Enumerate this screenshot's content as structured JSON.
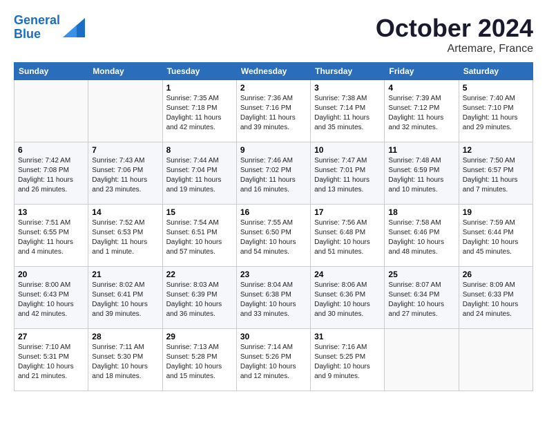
{
  "header": {
    "logo_line1": "General",
    "logo_line2": "Blue",
    "month": "October 2024",
    "location": "Artemare, France"
  },
  "days_of_week": [
    "Sunday",
    "Monday",
    "Tuesday",
    "Wednesday",
    "Thursday",
    "Friday",
    "Saturday"
  ],
  "weeks": [
    [
      {
        "day": "",
        "info": ""
      },
      {
        "day": "",
        "info": ""
      },
      {
        "day": "1",
        "info": "Sunrise: 7:35 AM\nSunset: 7:18 PM\nDaylight: 11 hours and 42 minutes."
      },
      {
        "day": "2",
        "info": "Sunrise: 7:36 AM\nSunset: 7:16 PM\nDaylight: 11 hours and 39 minutes."
      },
      {
        "day": "3",
        "info": "Sunrise: 7:38 AM\nSunset: 7:14 PM\nDaylight: 11 hours and 35 minutes."
      },
      {
        "day": "4",
        "info": "Sunrise: 7:39 AM\nSunset: 7:12 PM\nDaylight: 11 hours and 32 minutes."
      },
      {
        "day": "5",
        "info": "Sunrise: 7:40 AM\nSunset: 7:10 PM\nDaylight: 11 hours and 29 minutes."
      }
    ],
    [
      {
        "day": "6",
        "info": "Sunrise: 7:42 AM\nSunset: 7:08 PM\nDaylight: 11 hours and 26 minutes."
      },
      {
        "day": "7",
        "info": "Sunrise: 7:43 AM\nSunset: 7:06 PM\nDaylight: 11 hours and 23 minutes."
      },
      {
        "day": "8",
        "info": "Sunrise: 7:44 AM\nSunset: 7:04 PM\nDaylight: 11 hours and 19 minutes."
      },
      {
        "day": "9",
        "info": "Sunrise: 7:46 AM\nSunset: 7:02 PM\nDaylight: 11 hours and 16 minutes."
      },
      {
        "day": "10",
        "info": "Sunrise: 7:47 AM\nSunset: 7:01 PM\nDaylight: 11 hours and 13 minutes."
      },
      {
        "day": "11",
        "info": "Sunrise: 7:48 AM\nSunset: 6:59 PM\nDaylight: 11 hours and 10 minutes."
      },
      {
        "day": "12",
        "info": "Sunrise: 7:50 AM\nSunset: 6:57 PM\nDaylight: 11 hours and 7 minutes."
      }
    ],
    [
      {
        "day": "13",
        "info": "Sunrise: 7:51 AM\nSunset: 6:55 PM\nDaylight: 11 hours and 4 minutes."
      },
      {
        "day": "14",
        "info": "Sunrise: 7:52 AM\nSunset: 6:53 PM\nDaylight: 11 hours and 1 minute."
      },
      {
        "day": "15",
        "info": "Sunrise: 7:54 AM\nSunset: 6:51 PM\nDaylight: 10 hours and 57 minutes."
      },
      {
        "day": "16",
        "info": "Sunrise: 7:55 AM\nSunset: 6:50 PM\nDaylight: 10 hours and 54 minutes."
      },
      {
        "day": "17",
        "info": "Sunrise: 7:56 AM\nSunset: 6:48 PM\nDaylight: 10 hours and 51 minutes."
      },
      {
        "day": "18",
        "info": "Sunrise: 7:58 AM\nSunset: 6:46 PM\nDaylight: 10 hours and 48 minutes."
      },
      {
        "day": "19",
        "info": "Sunrise: 7:59 AM\nSunset: 6:44 PM\nDaylight: 10 hours and 45 minutes."
      }
    ],
    [
      {
        "day": "20",
        "info": "Sunrise: 8:00 AM\nSunset: 6:43 PM\nDaylight: 10 hours and 42 minutes."
      },
      {
        "day": "21",
        "info": "Sunrise: 8:02 AM\nSunset: 6:41 PM\nDaylight: 10 hours and 39 minutes."
      },
      {
        "day": "22",
        "info": "Sunrise: 8:03 AM\nSunset: 6:39 PM\nDaylight: 10 hours and 36 minutes."
      },
      {
        "day": "23",
        "info": "Sunrise: 8:04 AM\nSunset: 6:38 PM\nDaylight: 10 hours and 33 minutes."
      },
      {
        "day": "24",
        "info": "Sunrise: 8:06 AM\nSunset: 6:36 PM\nDaylight: 10 hours and 30 minutes."
      },
      {
        "day": "25",
        "info": "Sunrise: 8:07 AM\nSunset: 6:34 PM\nDaylight: 10 hours and 27 minutes."
      },
      {
        "day": "26",
        "info": "Sunrise: 8:09 AM\nSunset: 6:33 PM\nDaylight: 10 hours and 24 minutes."
      }
    ],
    [
      {
        "day": "27",
        "info": "Sunrise: 7:10 AM\nSunset: 5:31 PM\nDaylight: 10 hours and 21 minutes."
      },
      {
        "day": "28",
        "info": "Sunrise: 7:11 AM\nSunset: 5:30 PM\nDaylight: 10 hours and 18 minutes."
      },
      {
        "day": "29",
        "info": "Sunrise: 7:13 AM\nSunset: 5:28 PM\nDaylight: 10 hours and 15 minutes."
      },
      {
        "day": "30",
        "info": "Sunrise: 7:14 AM\nSunset: 5:26 PM\nDaylight: 10 hours and 12 minutes."
      },
      {
        "day": "31",
        "info": "Sunrise: 7:16 AM\nSunset: 5:25 PM\nDaylight: 10 hours and 9 minutes."
      },
      {
        "day": "",
        "info": ""
      },
      {
        "day": "",
        "info": ""
      }
    ]
  ]
}
